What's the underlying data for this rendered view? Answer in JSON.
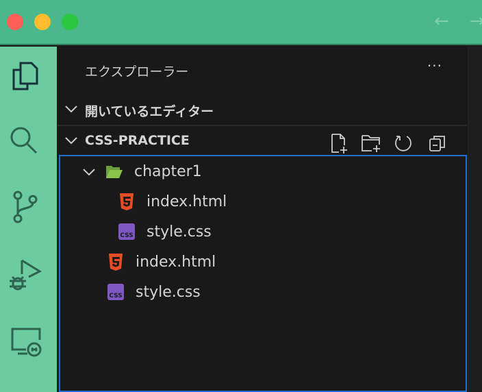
{
  "titlebar": {
    "back_icon": "arrow-left-icon",
    "forward_icon": "arrow-right-icon",
    "lights": [
      "#ff5f57",
      "#febc2e",
      "#28c840"
    ]
  },
  "activity_bar": {
    "items": [
      "files-icon",
      "search-icon",
      "source-control-icon",
      "run-debug-icon",
      "remote-explorer-icon"
    ],
    "color": "#6ccba0"
  },
  "explorer": {
    "title": "エクスプローラー",
    "more": "···",
    "open_editors": "開いているエディター",
    "workspace": "CSS-PRACTICE",
    "toolbar": [
      "new-file-icon",
      "new-folder-icon",
      "refresh-icon",
      "collapse-all-icon"
    ],
    "tree": [
      {
        "label": "chapter1",
        "type": "folder",
        "expanded": true,
        "depth": 0
      },
      {
        "label": "index.html",
        "type": "html",
        "depth": 1
      },
      {
        "label": "style.css",
        "type": "css",
        "depth": 1
      },
      {
        "label": "index.html",
        "type": "html",
        "depth": 0
      },
      {
        "label": "style.css",
        "type": "css",
        "depth": 0
      }
    ]
  }
}
